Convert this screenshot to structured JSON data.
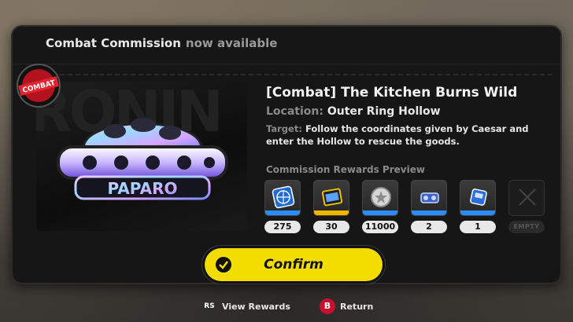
{
  "header": {
    "title_bold": "Combat Commission",
    "title_rest": "now available"
  },
  "badge": {
    "text": "COMBAT"
  },
  "preview": {
    "logo_text": "PAPARO",
    "bg_text": "RONIN"
  },
  "commission": {
    "title": "[Combat] The Kitchen Burns Wild",
    "location_label": "Location:",
    "location_value": "Outer Ring Hollow",
    "target_label": "Target:",
    "target_text": "Follow the coordinates given by Caesar and enter the Hollow to rescue the goods."
  },
  "rewards": {
    "title": "Commission Rewards Preview",
    "items": [
      {
        "icon": "globe-card-icon",
        "qty": "275",
        "bar": "#2b8cff"
      },
      {
        "icon": "film-reel-icon",
        "qty": "30",
        "bar": "#f0b400"
      },
      {
        "icon": "silver-coin-icon",
        "qty": "11000",
        "bar": "#2b8cff"
      },
      {
        "icon": "engine-part-icon",
        "qty": "2",
        "bar": "#2b8cff"
      },
      {
        "icon": "data-chip-icon",
        "qty": "1",
        "bar": "#2b8cff"
      },
      {
        "icon": "empty-slot-icon",
        "qty": "EMPTY",
        "bar": ""
      }
    ]
  },
  "confirm": {
    "label": "Confirm",
    "color": "#f3dd00"
  },
  "footer": {
    "rs_key": "RS",
    "rs_label": "View Rewards",
    "b_key": "B",
    "b_label": "Return"
  }
}
